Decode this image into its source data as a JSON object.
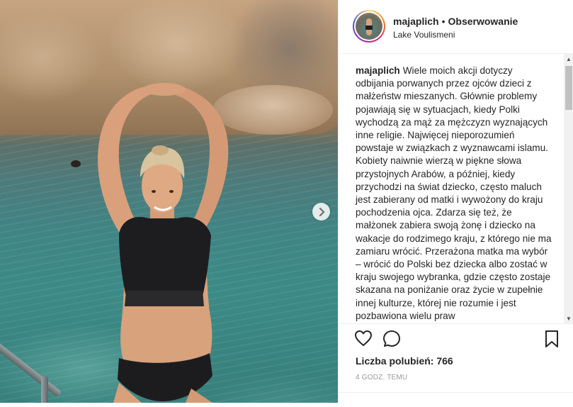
{
  "post": {
    "username": "majaplich",
    "separator": "•",
    "follow_label": "Obserwowanie",
    "location": "Lake Voulismeni"
  },
  "caption": {
    "username": "majaplich",
    "text": "Wiele moich akcji dotyczy odbijania porwanych przez ojców dzieci z małżeństw mieszanych. Głównie problemy pojawiają się w sytuacjach, kiedy Polki wychodzą za mąż za mężczyzn wyznających inne religie. Najwięcej nieporozumień powstaje w związkach z wyznawcami islamu. Kobiety naiwnie wierzą w piękne słowa przystojnych Arabów, a później, kiedy przychodzi na świat dziecko, często maluch jest zabierany od matki i wywożony do kraju pochodzenia ojca. Zdarza się też, że małżonek zabiera swoją żonę i dziecko na wakacje do rodzimego kraju, z którego nie ma zamiaru wrócić. Przerażona matka ma wybór – wrócić do Polski bez dziecka albo zostać w kraju swojego wybranka, gdzie często zostaje skazana na poniżanie oraz życie w zupełnie innej kulturze, której nie rozumie i jest pozbawiona wielu praw"
  },
  "stats": {
    "likes_label": "Liczba polubień: 766",
    "time_label": "4 GODZ. TEMU"
  },
  "icons": {
    "like": "heart-icon",
    "comment": "comment-icon",
    "save": "bookmark-icon",
    "next": "chevron-right-icon"
  }
}
